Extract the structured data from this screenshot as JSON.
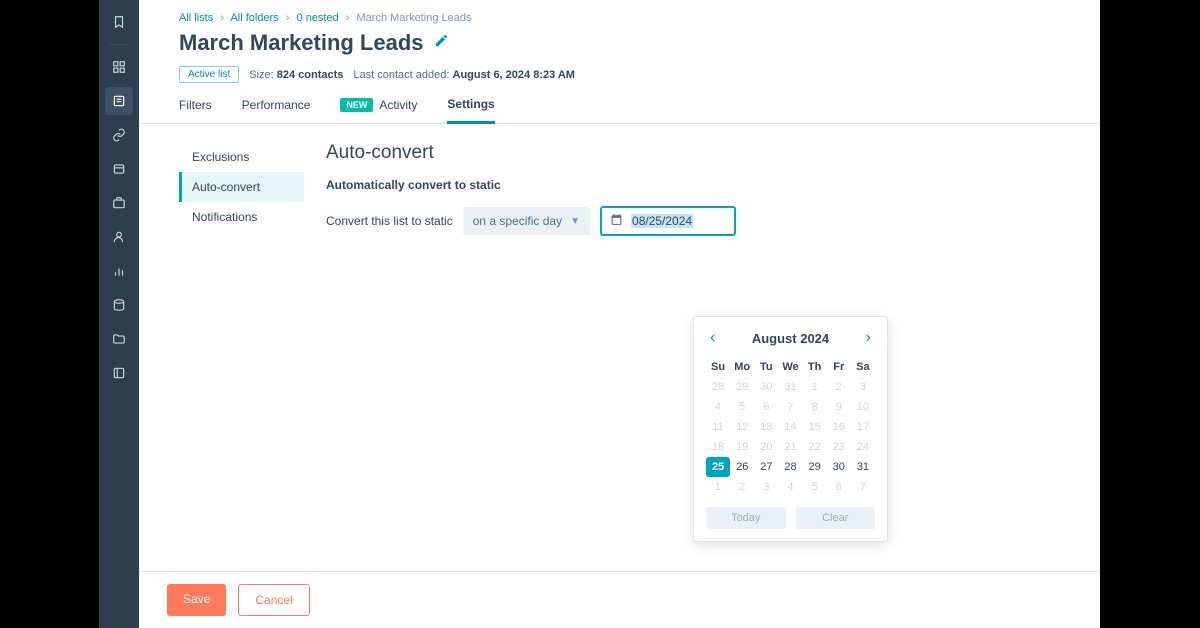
{
  "breadcrumb": {
    "items": [
      "All lists",
      "All folders",
      "0 nested"
    ],
    "current": "March Marketing Leads"
  },
  "page": {
    "title": "March Marketing Leads",
    "badge": "Active list",
    "size_label": "Size:",
    "size_value": "824 contacts",
    "last_label": "Last contact added:",
    "last_value": "August 6, 2024 8:23 AM"
  },
  "tabs": {
    "items": [
      "Filters",
      "Performance",
      "Activity",
      "Settings"
    ],
    "new_pill": "NEW",
    "active": "Settings"
  },
  "subnav": {
    "items": [
      "Exclusions",
      "Auto-convert",
      "Notifications"
    ],
    "active": "Auto-convert"
  },
  "panel": {
    "heading": "Auto-convert",
    "section_label": "Automatically convert to static",
    "row_label": "Convert this list to static",
    "dropdown_value": "on a specific day",
    "date_value": "08/25/2024"
  },
  "calendar": {
    "month_label": "August 2024",
    "weekdays": [
      "Su",
      "Mo",
      "Tu",
      "We",
      "Th",
      "Fr",
      "Sa"
    ],
    "leading": [
      28,
      29,
      30,
      31,
      1,
      2,
      3,
      4,
      5,
      6,
      7,
      8,
      9,
      10,
      11,
      12,
      13,
      14,
      15,
      16,
      17,
      18,
      19,
      20,
      21,
      22,
      23,
      24
    ],
    "current_row": [
      25,
      26,
      27,
      28,
      29,
      30,
      31
    ],
    "trailing": [
      1,
      2,
      3,
      4,
      5,
      6,
      7
    ],
    "selected": 25,
    "today_label": "Today",
    "clear_label": "Clear"
  },
  "footer": {
    "save": "Save",
    "cancel": "Cancel"
  },
  "nav_icons": [
    "bookmark",
    "dashboard",
    "list",
    "link",
    "layers",
    "briefcase",
    "user",
    "chart",
    "database",
    "folder",
    "app"
  ]
}
